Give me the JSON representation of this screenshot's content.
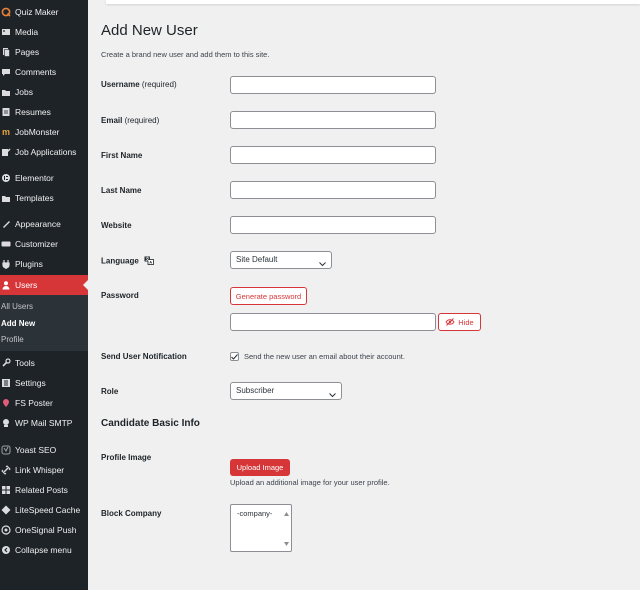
{
  "sidebar": {
    "items": [
      {
        "label": "Quiz Maker",
        "icon": "quiz-maker-icon"
      },
      {
        "label": "Media",
        "icon": "media-icon"
      },
      {
        "label": "Pages",
        "icon": "pages-icon"
      },
      {
        "label": "Comments",
        "icon": "comments-icon"
      },
      {
        "label": "Jobs",
        "icon": "jobs-icon"
      },
      {
        "label": "Resumes",
        "icon": "resumes-icon"
      },
      {
        "label": "JobMonster",
        "icon": "jobmonster-icon"
      },
      {
        "label": "Job Applications",
        "icon": "job-applications-icon"
      },
      {
        "label": "Elementor",
        "icon": "elementor-icon"
      },
      {
        "label": "Templates",
        "icon": "templates-icon"
      },
      {
        "label": "Appearance",
        "icon": "appearance-icon"
      },
      {
        "label": "Customizer",
        "icon": "customizer-icon"
      },
      {
        "label": "Plugins",
        "icon": "plugins-icon"
      },
      {
        "label": "Users",
        "icon": "users-icon"
      },
      {
        "label": "Tools",
        "icon": "tools-icon"
      },
      {
        "label": "Settings",
        "icon": "settings-icon"
      },
      {
        "label": "FS Poster",
        "icon": "fs-poster-icon"
      },
      {
        "label": "WP Mail SMTP",
        "icon": "wp-mail-smtp-icon"
      },
      {
        "label": "Yoast SEO",
        "icon": "yoast-seo-icon"
      },
      {
        "label": "Link Whisper",
        "icon": "link-whisper-icon"
      },
      {
        "label": "Related Posts",
        "icon": "related-posts-icon"
      },
      {
        "label": "LiteSpeed Cache",
        "icon": "litespeed-cache-icon"
      },
      {
        "label": "OneSignal Push",
        "icon": "onesignal-push-icon"
      },
      {
        "label": "Collapse menu",
        "icon": "collapse-menu-icon"
      }
    ],
    "submenu": [
      "All Users",
      "Add New",
      "Profile"
    ],
    "active_item": "Users",
    "current_submenu": "Add New"
  },
  "page": {
    "title": "Add New User",
    "description": "Create a brand new user and add them to this site."
  },
  "form": {
    "username_label": "Username",
    "username_required": "(required)",
    "username_value": "",
    "email_label": "Email",
    "email_required": "(required)",
    "email_value": "",
    "first_name_label": "First Name",
    "first_name_value": "",
    "last_name_label": "Last Name",
    "last_name_value": "",
    "website_label": "Website",
    "website_value": "",
    "language_label": "Language",
    "language_value": "Site Default",
    "password_label": "Password",
    "generate_password_label": "Generate password",
    "password_value": "",
    "hide_label": "Hide",
    "notification_label": "Send User Notification",
    "notification_text": "Send the new user an email about their account.",
    "notification_checked": true,
    "role_label": "Role",
    "role_value": "Subscriber"
  },
  "candidate": {
    "section_title": "Candidate Basic Info",
    "profile_image_label": "Profile Image",
    "upload_button_label": "Upload Image",
    "upload_hint": "Upload an additional image for your user profile.",
    "block_company_label": "Block Company",
    "block_company_option": "-company-"
  },
  "colors": {
    "sidebar_bg": "#1d2327",
    "active_menu": "#d63638",
    "accent": "#d63638",
    "page_bg": "#f0f0f1"
  }
}
